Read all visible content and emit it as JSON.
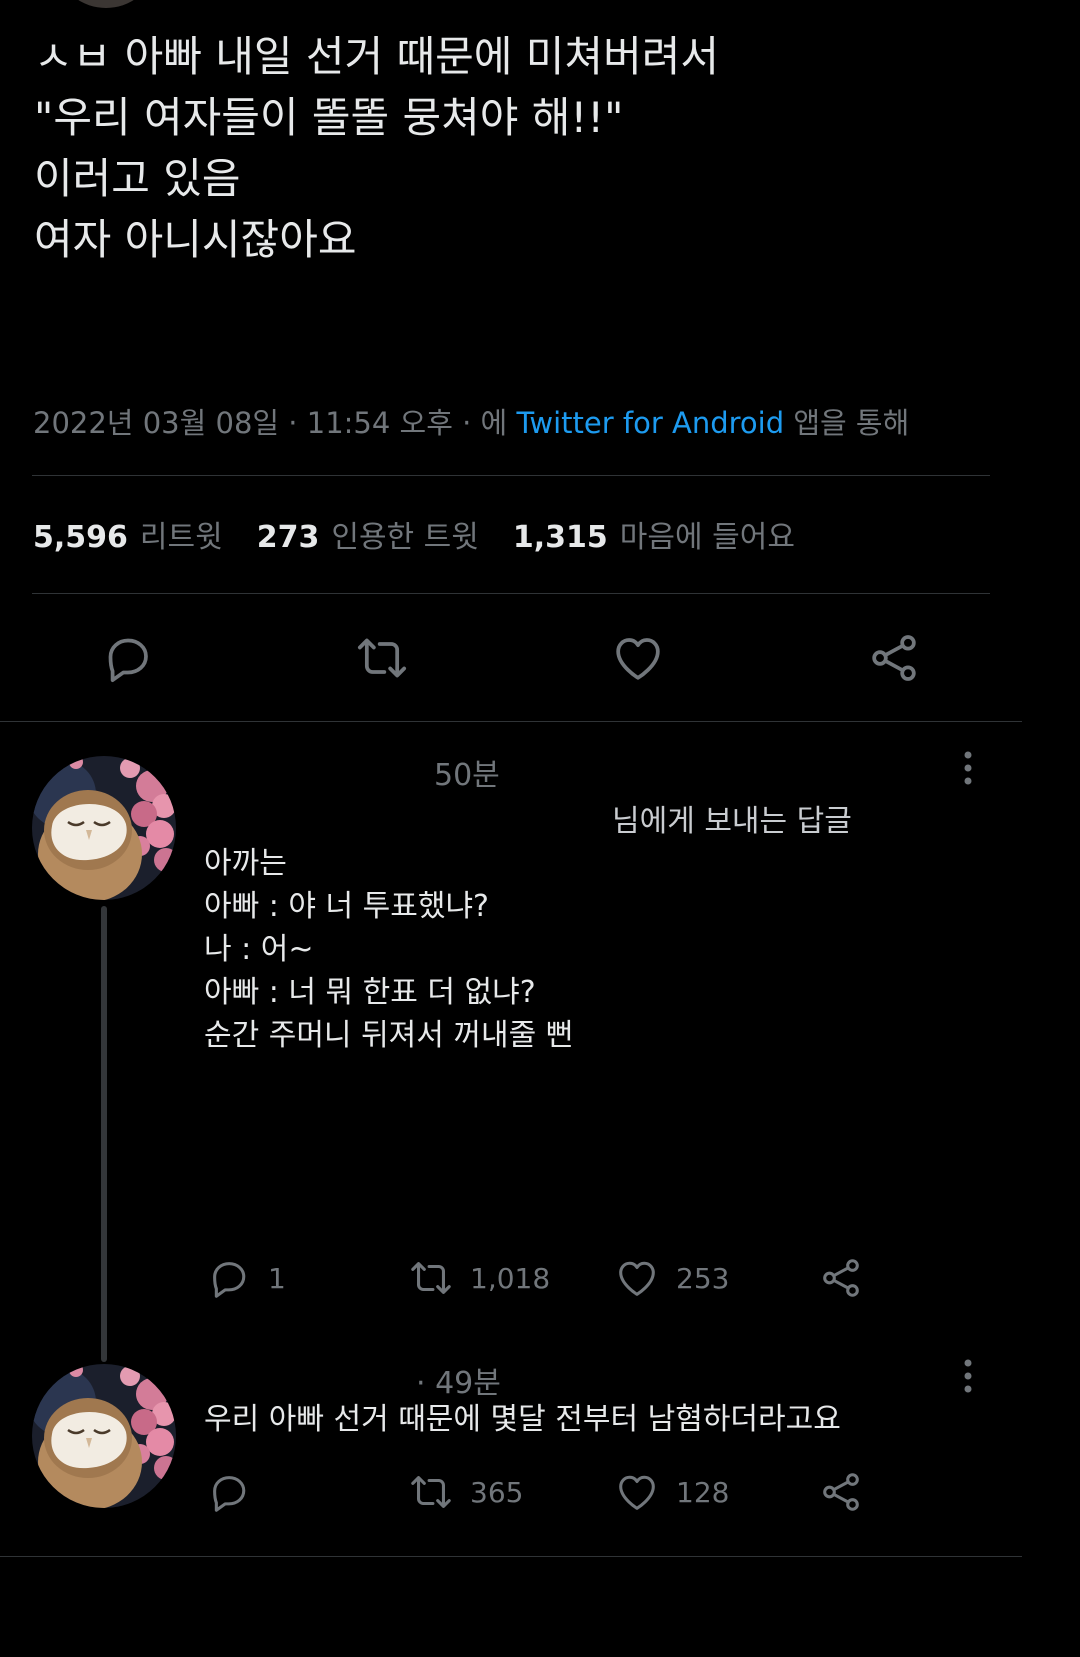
{
  "main_tweet": {
    "lines": [
      "ㅅㅂ 아빠 내일 선거 때문에 미쳐버려서",
      "",
      "\"우리 여자들이 똘똘 뭉쳐야 해!!\"",
      "이러고 있음",
      "",
      "여자 아니시잖아요"
    ],
    "date": "2022년 03월 08일",
    "sep1": " · ",
    "time": "11:54 오후",
    "sep2": " · 에 ",
    "source": "Twitter for Android",
    "source_suffix": " 앱을 통해",
    "stats": {
      "retweets": "5,596",
      "retweets_label": "리트윗",
      "quotes": "273",
      "quotes_label": "인용한 트윗",
      "likes": "1,315",
      "likes_label": "마음에 들어요"
    },
    "actions": [
      "reply-icon",
      "retweet-icon",
      "heart-icon",
      "share-icon"
    ]
  },
  "replies": [
    {
      "time": "50분",
      "replying_to": "님에게 보내는 답글",
      "body": [
        "아까는",
        "",
        "아빠 : 야 너 투표했냐?",
        "",
        "나 : 어~",
        "",
        "아빠 : 너 뭐 한표 더 없냐?",
        "",
        "순간 주머니 뒤져서 꺼내줄 뻔"
      ],
      "reply_count": "1",
      "retweet_count": "1,018",
      "like_count": "253"
    },
    {
      "time": "· 49분",
      "body": [
        "우리 아빠 선거 때문에 몇달 전부터 남혐하더라고요"
      ],
      "reply_count": "",
      "retweet_count": "365",
      "like_count": "128"
    }
  ],
  "colors": {
    "background": "#000000",
    "text": "#e7e9ea",
    "muted": "#71767b",
    "link": "#1d9bf0",
    "divider": "#2f3336"
  }
}
